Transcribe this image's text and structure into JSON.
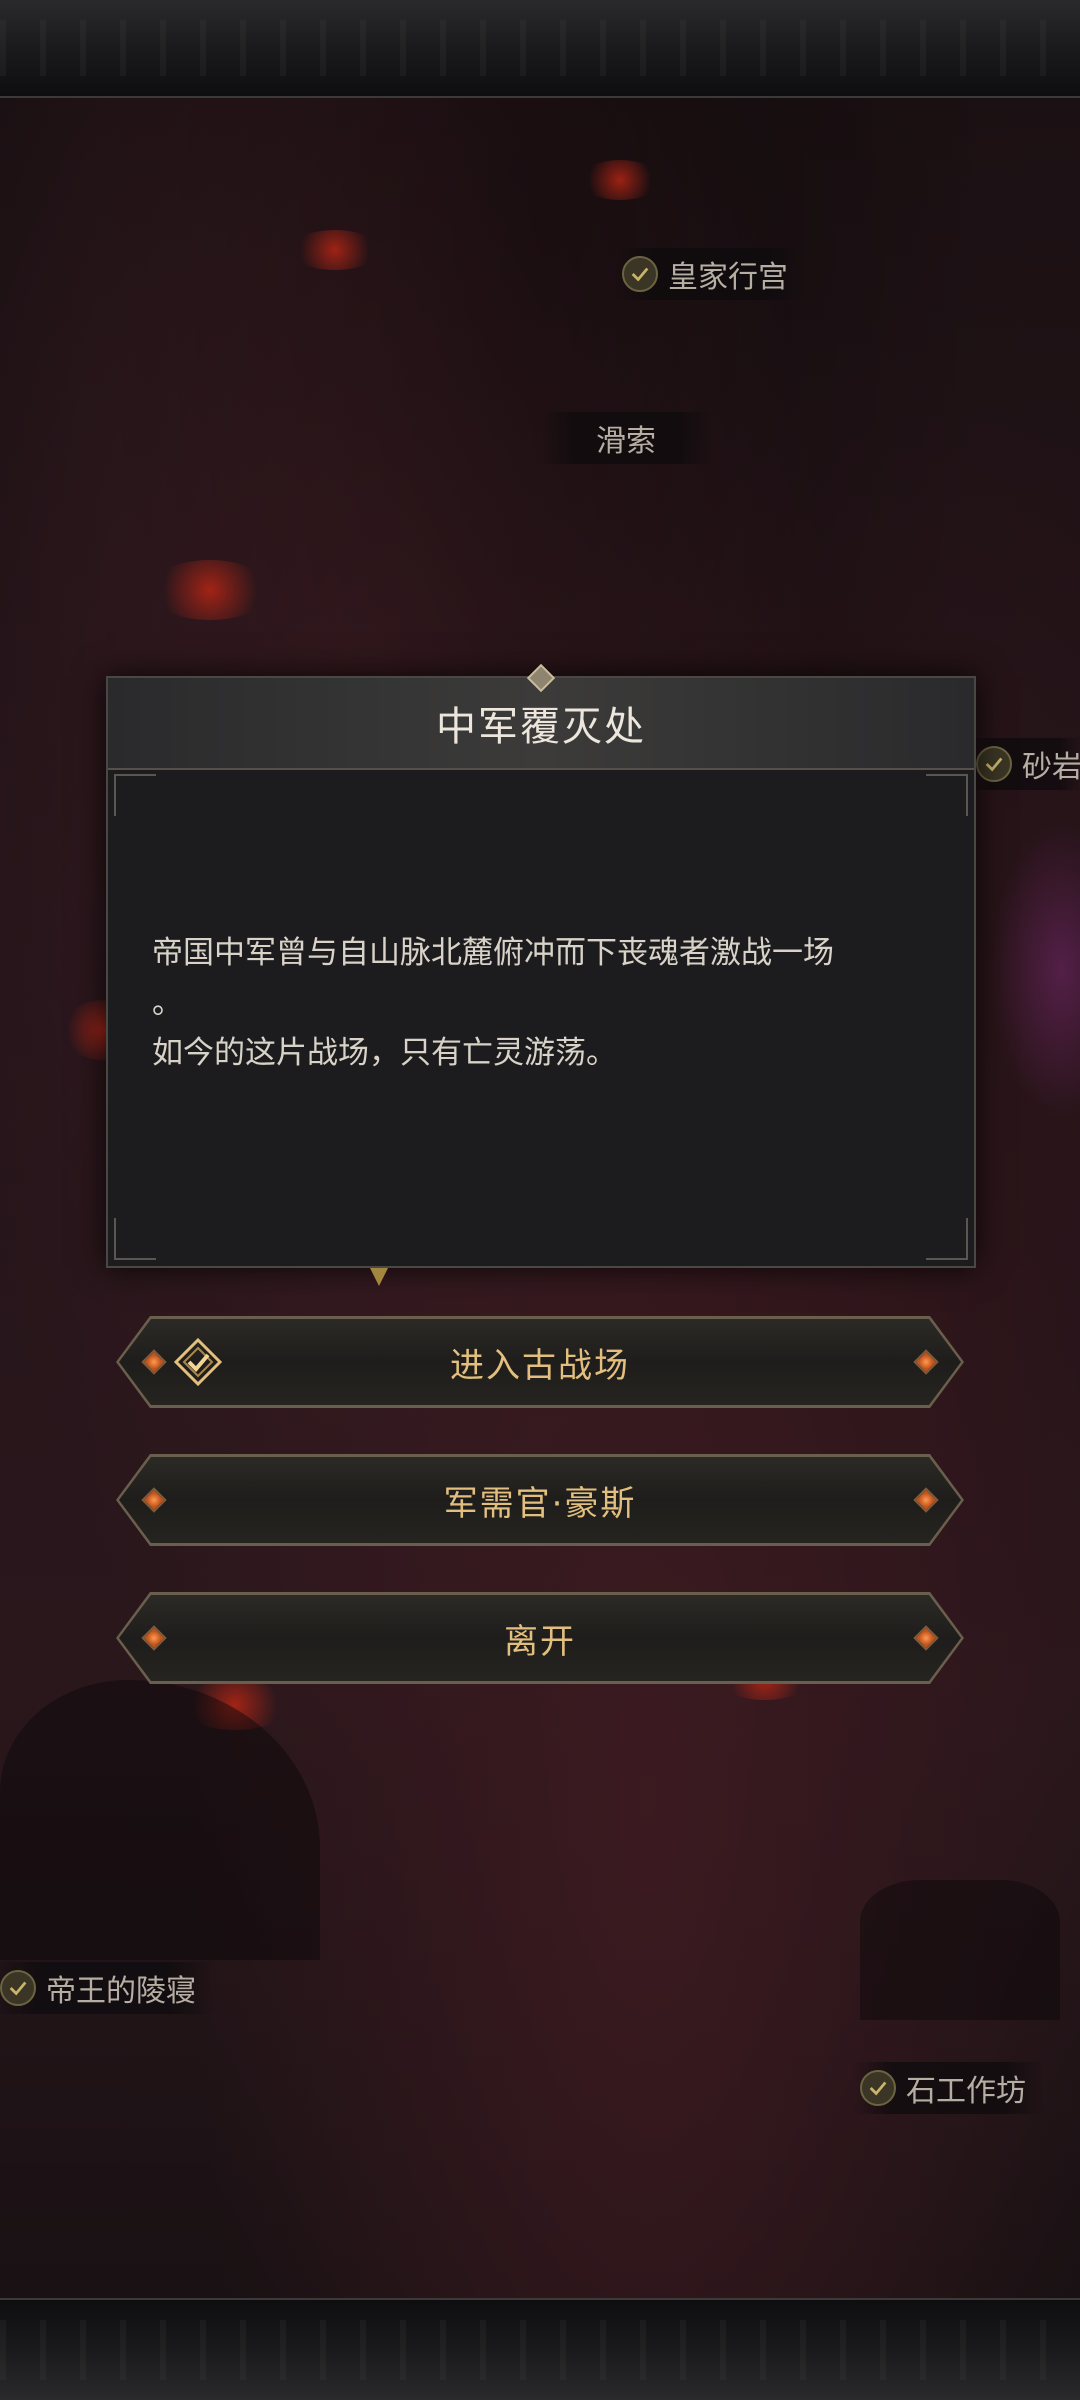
{
  "map": {
    "locations": [
      {
        "id": "royal-palace",
        "label": "皇家行宫",
        "visited": true
      },
      {
        "id": "zipline",
        "label": "滑索",
        "visited": false
      },
      {
        "id": "sand-rock",
        "label": "砂岩",
        "visited": true
      },
      {
        "id": "emperor-tomb",
        "label": "帝王的陵寝",
        "visited": true
      },
      {
        "id": "stone-workshop",
        "label": "石工作坊",
        "visited": true
      }
    ]
  },
  "dialog": {
    "title": "中军覆灭处",
    "description_lines": [
      "帝国中军曾与自山脉北麓俯冲而下丧魂者激战一场",
      "。",
      "如今的这片战场，只有亡灵游荡。"
    ]
  },
  "actions": [
    {
      "label": "进入古战场",
      "icon": "enter-checkmark-icon"
    },
    {
      "label": "军需官·豪斯"
    },
    {
      "label": "离开"
    }
  ],
  "colors": {
    "button_text": "#e2bf7e",
    "dialog_bg": "#1c1c1e",
    "accent_gem": "#ff9a50"
  }
}
